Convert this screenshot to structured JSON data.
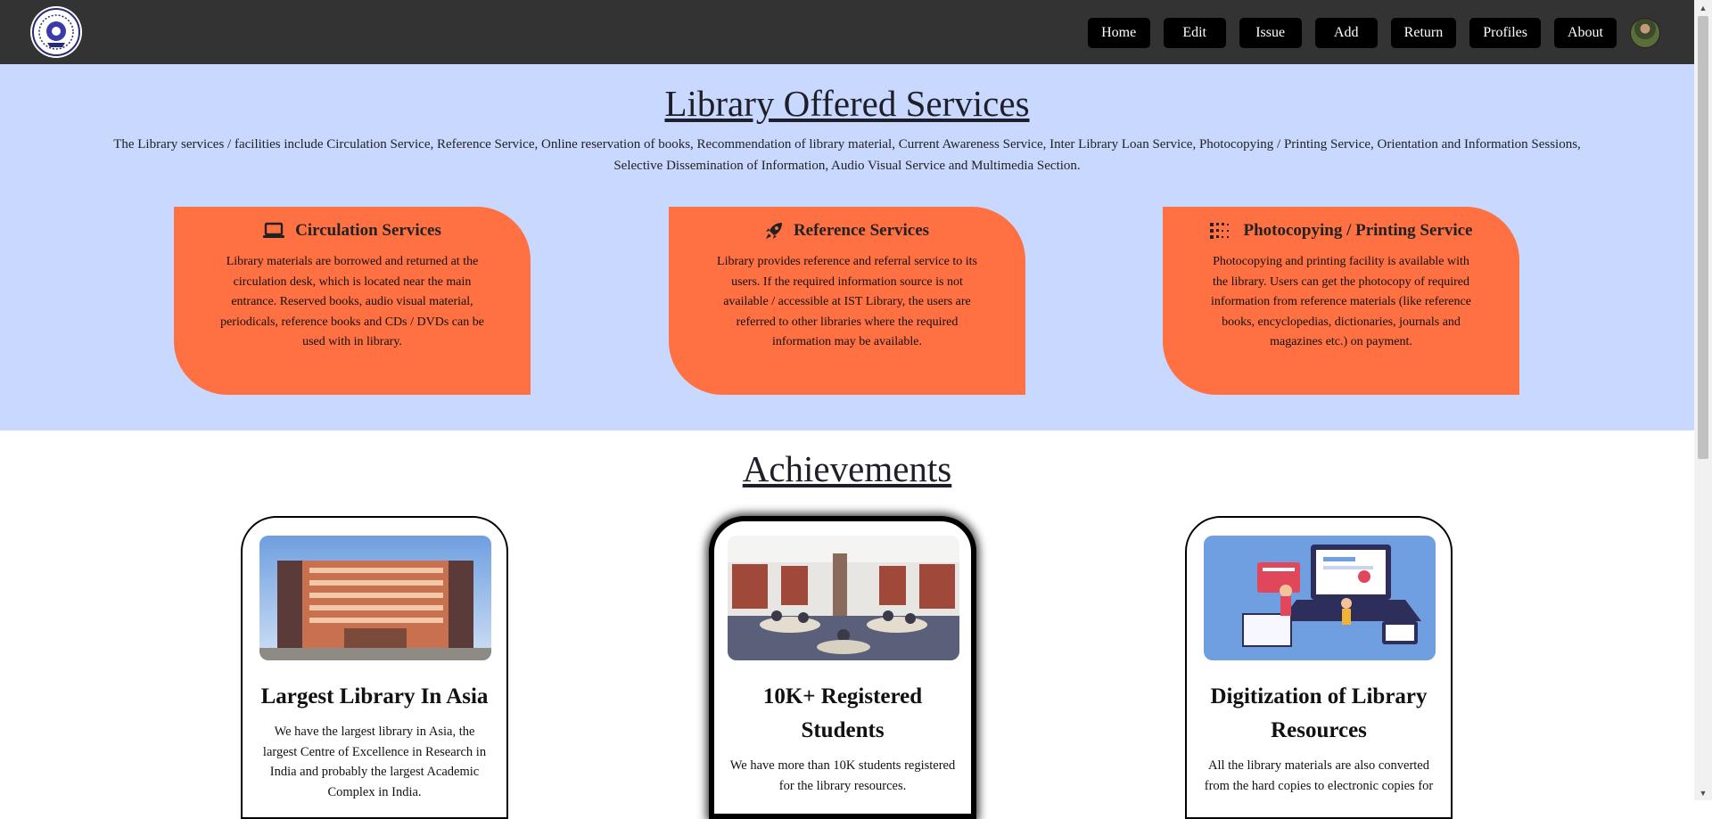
{
  "nav": {
    "logo_alt": "Institute emblem",
    "items": [
      {
        "label": "Home"
      },
      {
        "label": "Edit"
      },
      {
        "label": "Issue"
      },
      {
        "label": "Add"
      },
      {
        "label": "Return"
      },
      {
        "label": "Profiles"
      },
      {
        "label": "About"
      }
    ]
  },
  "services": {
    "title": "Library Offered Services",
    "intro": "The Library services / facilities include Circulation Service, Reference Service, Online reservation of books, Recommendation of library material, Current Awareness Service, Inter Library Loan Service, Photocopying / Printing Service, Orientation and Information Sessions, Selective Dissemination of Information, Audio Visual Service and Multimedia Section.",
    "cards": [
      {
        "icon": "laptop-icon",
        "title": "Circulation Services",
        "text": "Library materials are borrowed and returned at the circulation desk, which is located near the main entrance. Reserved books, audio visual material, periodicals, reference books and CDs / DVDs can be used with in library."
      },
      {
        "icon": "rocket-icon",
        "title": "Reference Services",
        "text": "Library provides reference and referral service to its users. If the required information source is not available / accessible at IST Library, the users are referred to other libraries where the required information may be available."
      },
      {
        "icon": "grid-icon",
        "title": "Photocopying / Printing Service",
        "text": "Photocopying and printing facility is available with the library. Users can get the photocopy of required information from reference materials (like reference books, encyclopedias, dictionaries, journals and magazines etc.) on payment."
      }
    ]
  },
  "achievements": {
    "title": "Achievements",
    "cards": [
      {
        "image": "library-building-photo",
        "title": "Largest Library In Asia",
        "text": "We have the largest library in Asia, the largest Centre of Excellence in Research in India and probably the largest Academic Complex in India."
      },
      {
        "image": "reading-room-photo",
        "title": "10K+ Registered Students",
        "text": "We have more than 10K students registered for the library resources."
      },
      {
        "image": "digital-library-illustration",
        "title": "Digitization of Library Resources",
        "text": "All the library materials are also converted from the hard copies to electronic copies for"
      }
    ]
  },
  "colors": {
    "navbar": "#333333",
    "services_bg": "#c9d8ff",
    "card_accent": "#ff7043",
    "button_bg": "#000000"
  }
}
